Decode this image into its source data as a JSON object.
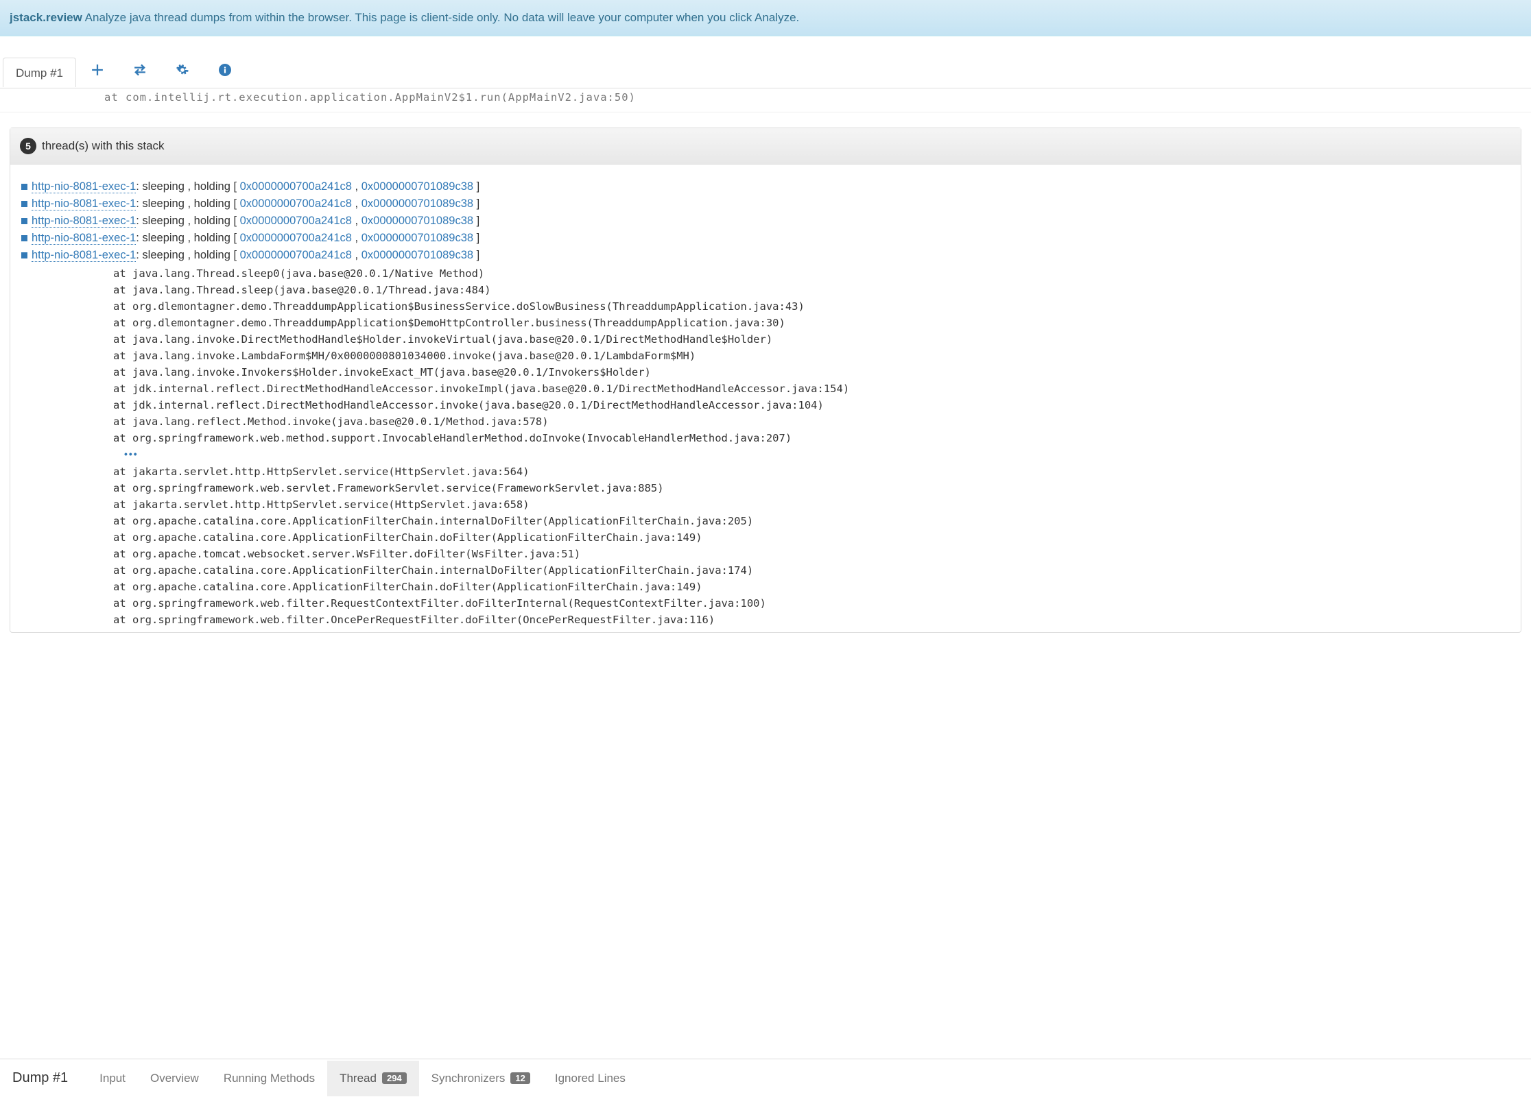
{
  "banner": {
    "brand": "jstack.review",
    "text": "Analyze java thread dumps from within the browser. This page is client-side only. No data will leave your computer when you click Analyze."
  },
  "tabs": {
    "dump_label": "Dump #1"
  },
  "partial_top": "at com.intellij.rt.execution.application.AppMainV2$1.run(AppMainV2.java:50)",
  "panel": {
    "count": "5",
    "title": "thread(s) with this stack",
    "threads": [
      {
        "name": "http-nio-8081-exec-1",
        "state": ": sleeping , holding [ ",
        "lock1": "0x0000000700a241c8",
        "sep": " , ",
        "lock2": "0x0000000701089c38",
        "end": " ]"
      },
      {
        "name": "http-nio-8081-exec-1",
        "state": ": sleeping , holding [ ",
        "lock1": "0x0000000700a241c8",
        "sep": " , ",
        "lock2": "0x0000000701089c38",
        "end": " ]"
      },
      {
        "name": "http-nio-8081-exec-1",
        "state": ": sleeping , holding [ ",
        "lock1": "0x0000000700a241c8",
        "sep": " , ",
        "lock2": "0x0000000701089c38",
        "end": " ]"
      },
      {
        "name": "http-nio-8081-exec-1",
        "state": ": sleeping , holding [ ",
        "lock1": "0x0000000700a241c8",
        "sep": " , ",
        "lock2": "0x0000000701089c38",
        "end": " ]"
      },
      {
        "name": "http-nio-8081-exec-1",
        "state": ": sleeping , holding [ ",
        "lock1": "0x0000000700a241c8",
        "sep": " , ",
        "lock2": "0x0000000701089c38",
        "end": " ]"
      }
    ],
    "stack1": "at java.lang.Thread.sleep0(java.base@20.0.1/Native Method)\nat java.lang.Thread.sleep(java.base@20.0.1/Thread.java:484)\nat org.dlemontagner.demo.ThreaddumpApplication$BusinessService.doSlowBusiness(ThreaddumpApplication.java:43)\nat org.dlemontagner.demo.ThreaddumpApplication$DemoHttpController.business(ThreaddumpApplication.java:30)\nat java.lang.invoke.DirectMethodHandle$Holder.invokeVirtual(java.base@20.0.1/DirectMethodHandle$Holder)\nat java.lang.invoke.LambdaForm$MH/0x0000000801034000.invoke(java.base@20.0.1/LambdaForm$MH)\nat java.lang.invoke.Invokers$Holder.invokeExact_MT(java.base@20.0.1/Invokers$Holder)\nat jdk.internal.reflect.DirectMethodHandleAccessor.invokeImpl(java.base@20.0.1/DirectMethodHandleAccessor.java:154)\nat jdk.internal.reflect.DirectMethodHandleAccessor.invoke(java.base@20.0.1/DirectMethodHandleAccessor.java:104)\nat java.lang.reflect.Method.invoke(java.base@20.0.1/Method.java:578)\nat org.springframework.web.method.support.InvocableHandlerMethod.doInvoke(InvocableHandlerMethod.java:207)",
    "ellipsis": "•••",
    "stack2": "at jakarta.servlet.http.HttpServlet.service(HttpServlet.java:564)\nat org.springframework.web.servlet.FrameworkServlet.service(FrameworkServlet.java:885)\nat jakarta.servlet.http.HttpServlet.service(HttpServlet.java:658)\nat org.apache.catalina.core.ApplicationFilterChain.internalDoFilter(ApplicationFilterChain.java:205)\nat org.apache.catalina.core.ApplicationFilterChain.doFilter(ApplicationFilterChain.java:149)\nat org.apache.tomcat.websocket.server.WsFilter.doFilter(WsFilter.java:51)\nat org.apache.catalina.core.ApplicationFilterChain.internalDoFilter(ApplicationFilterChain.java:174)\nat org.apache.catalina.core.ApplicationFilterChain.doFilter(ApplicationFilterChain.java:149)\nat org.springframework.web.filter.RequestContextFilter.doFilterInternal(RequestContextFilter.java:100)\nat org.springframework.web.filter.OncePerRequestFilter.doFilter(OncePerRequestFilter.java:116)"
  },
  "bottom": {
    "dump_label": "Dump #1",
    "tabs": {
      "input": "Input",
      "overview": "Overview",
      "running": "Running Methods",
      "thread": "Thread",
      "thread_badge": "294",
      "sync": "Synchronizers",
      "sync_badge": "12",
      "ignored": "Ignored Lines"
    }
  }
}
